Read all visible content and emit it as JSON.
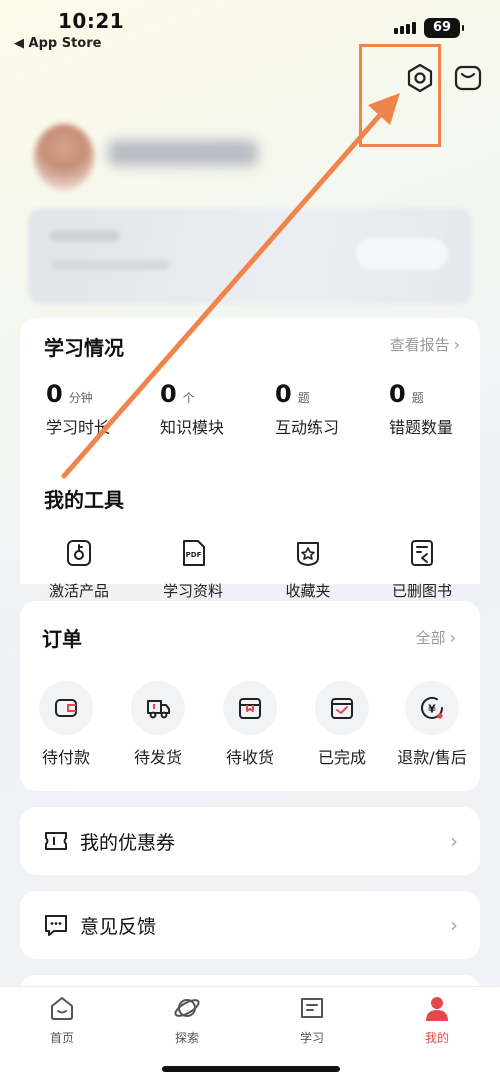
{
  "status_bar": {
    "time": "10:21",
    "back_app": "◀ App Store",
    "battery": "69"
  },
  "top_icons": {
    "settings": "settings-icon",
    "message": "message-icon"
  },
  "study_section": {
    "title": "学习情况",
    "report_link": "查看报告",
    "stats": [
      {
        "value": "0",
        "unit": "分钟",
        "label": "学习时长"
      },
      {
        "value": "0",
        "unit": "个",
        "label": "知识模块"
      },
      {
        "value": "0",
        "unit": "题",
        "label": "互动练习"
      },
      {
        "value": "0",
        "unit": "题",
        "label": "错题数量"
      }
    ]
  },
  "tools_section": {
    "title": "我的工具",
    "items": [
      {
        "label": "激活产品",
        "icon": "key-icon"
      },
      {
        "label": "学习资料",
        "icon": "pdf-icon"
      },
      {
        "label": "收藏夹",
        "icon": "star-icon"
      },
      {
        "label": "已删图书",
        "icon": "book-icon"
      }
    ]
  },
  "orders_section": {
    "title": "订单",
    "all_link": "全部",
    "items": [
      {
        "label": "待付款",
        "icon": "wallet-icon"
      },
      {
        "label": "待发货",
        "icon": "truck-icon"
      },
      {
        "label": "待收货",
        "icon": "box-icon"
      },
      {
        "label": "已完成",
        "icon": "check-box-icon"
      },
      {
        "label": "退款/售后",
        "icon": "refund-icon"
      }
    ]
  },
  "coupons": {
    "label": "我的优惠券"
  },
  "feedback": {
    "label": "意见反馈"
  },
  "tab_bar": [
    {
      "label": "首页",
      "icon": "home-icon",
      "active": false
    },
    {
      "label": "探索",
      "icon": "planet-icon",
      "active": false
    },
    {
      "label": "学习",
      "icon": "book-open-icon",
      "active": false
    },
    {
      "label": "我的",
      "icon": "person-icon",
      "active": true
    }
  ],
  "colors": {
    "accent": "#e5484d",
    "annotation": "#f0844a",
    "muted": "#9a9a9a"
  }
}
